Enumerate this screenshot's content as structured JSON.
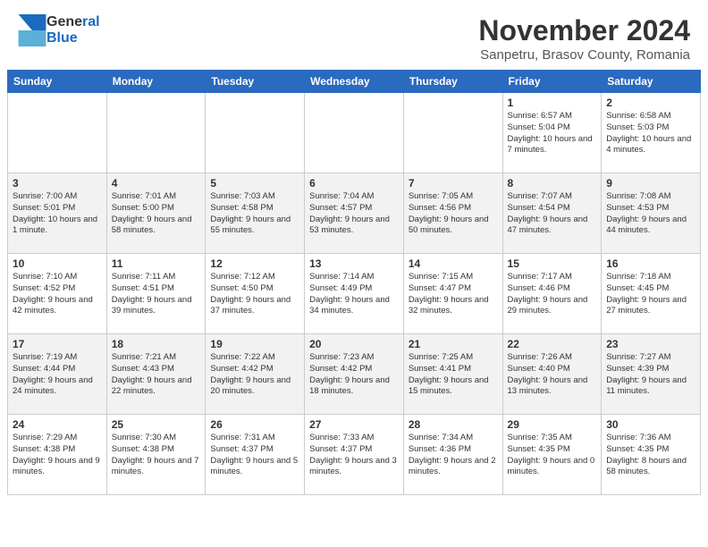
{
  "header": {
    "logo_line1": "General",
    "logo_line2": "Blue",
    "title": "November 2024",
    "subtitle": "Sanpetru, Brasov County, Romania"
  },
  "days_of_week": [
    "Sunday",
    "Monday",
    "Tuesday",
    "Wednesday",
    "Thursday",
    "Friday",
    "Saturday"
  ],
  "weeks": [
    [
      {
        "day": "",
        "info": ""
      },
      {
        "day": "",
        "info": ""
      },
      {
        "day": "",
        "info": ""
      },
      {
        "day": "",
        "info": ""
      },
      {
        "day": "",
        "info": ""
      },
      {
        "day": "1",
        "info": "Sunrise: 6:57 AM\nSunset: 5:04 PM\nDaylight: 10 hours\nand 7 minutes."
      },
      {
        "day": "2",
        "info": "Sunrise: 6:58 AM\nSunset: 5:03 PM\nDaylight: 10 hours\nand 4 minutes."
      }
    ],
    [
      {
        "day": "3",
        "info": "Sunrise: 7:00 AM\nSunset: 5:01 PM\nDaylight: 10 hours\nand 1 minute."
      },
      {
        "day": "4",
        "info": "Sunrise: 7:01 AM\nSunset: 5:00 PM\nDaylight: 9 hours\nand 58 minutes."
      },
      {
        "day": "5",
        "info": "Sunrise: 7:03 AM\nSunset: 4:58 PM\nDaylight: 9 hours\nand 55 minutes."
      },
      {
        "day": "6",
        "info": "Sunrise: 7:04 AM\nSunset: 4:57 PM\nDaylight: 9 hours\nand 53 minutes."
      },
      {
        "day": "7",
        "info": "Sunrise: 7:05 AM\nSunset: 4:56 PM\nDaylight: 9 hours\nand 50 minutes."
      },
      {
        "day": "8",
        "info": "Sunrise: 7:07 AM\nSunset: 4:54 PM\nDaylight: 9 hours\nand 47 minutes."
      },
      {
        "day": "9",
        "info": "Sunrise: 7:08 AM\nSunset: 4:53 PM\nDaylight: 9 hours\nand 44 minutes."
      }
    ],
    [
      {
        "day": "10",
        "info": "Sunrise: 7:10 AM\nSunset: 4:52 PM\nDaylight: 9 hours\nand 42 minutes."
      },
      {
        "day": "11",
        "info": "Sunrise: 7:11 AM\nSunset: 4:51 PM\nDaylight: 9 hours\nand 39 minutes."
      },
      {
        "day": "12",
        "info": "Sunrise: 7:12 AM\nSunset: 4:50 PM\nDaylight: 9 hours\nand 37 minutes."
      },
      {
        "day": "13",
        "info": "Sunrise: 7:14 AM\nSunset: 4:49 PM\nDaylight: 9 hours\nand 34 minutes."
      },
      {
        "day": "14",
        "info": "Sunrise: 7:15 AM\nSunset: 4:47 PM\nDaylight: 9 hours\nand 32 minutes."
      },
      {
        "day": "15",
        "info": "Sunrise: 7:17 AM\nSunset: 4:46 PM\nDaylight: 9 hours\nand 29 minutes."
      },
      {
        "day": "16",
        "info": "Sunrise: 7:18 AM\nSunset: 4:45 PM\nDaylight: 9 hours\nand 27 minutes."
      }
    ],
    [
      {
        "day": "17",
        "info": "Sunrise: 7:19 AM\nSunset: 4:44 PM\nDaylight: 9 hours\nand 24 minutes."
      },
      {
        "day": "18",
        "info": "Sunrise: 7:21 AM\nSunset: 4:43 PM\nDaylight: 9 hours\nand 22 minutes."
      },
      {
        "day": "19",
        "info": "Sunrise: 7:22 AM\nSunset: 4:42 PM\nDaylight: 9 hours\nand 20 minutes."
      },
      {
        "day": "20",
        "info": "Sunrise: 7:23 AM\nSunset: 4:42 PM\nDaylight: 9 hours\nand 18 minutes."
      },
      {
        "day": "21",
        "info": "Sunrise: 7:25 AM\nSunset: 4:41 PM\nDaylight: 9 hours\nand 15 minutes."
      },
      {
        "day": "22",
        "info": "Sunrise: 7:26 AM\nSunset: 4:40 PM\nDaylight: 9 hours\nand 13 minutes."
      },
      {
        "day": "23",
        "info": "Sunrise: 7:27 AM\nSunset: 4:39 PM\nDaylight: 9 hours\nand 11 minutes."
      }
    ],
    [
      {
        "day": "24",
        "info": "Sunrise: 7:29 AM\nSunset: 4:38 PM\nDaylight: 9 hours\nand 9 minutes."
      },
      {
        "day": "25",
        "info": "Sunrise: 7:30 AM\nSunset: 4:38 PM\nDaylight: 9 hours\nand 7 minutes."
      },
      {
        "day": "26",
        "info": "Sunrise: 7:31 AM\nSunset: 4:37 PM\nDaylight: 9 hours\nand 5 minutes."
      },
      {
        "day": "27",
        "info": "Sunrise: 7:33 AM\nSunset: 4:37 PM\nDaylight: 9 hours\nand 3 minutes."
      },
      {
        "day": "28",
        "info": "Sunrise: 7:34 AM\nSunset: 4:36 PM\nDaylight: 9 hours\nand 2 minutes."
      },
      {
        "day": "29",
        "info": "Sunrise: 7:35 AM\nSunset: 4:35 PM\nDaylight: 9 hours\nand 0 minutes."
      },
      {
        "day": "30",
        "info": "Sunrise: 7:36 AM\nSunset: 4:35 PM\nDaylight: 8 hours\nand 58 minutes."
      }
    ]
  ]
}
